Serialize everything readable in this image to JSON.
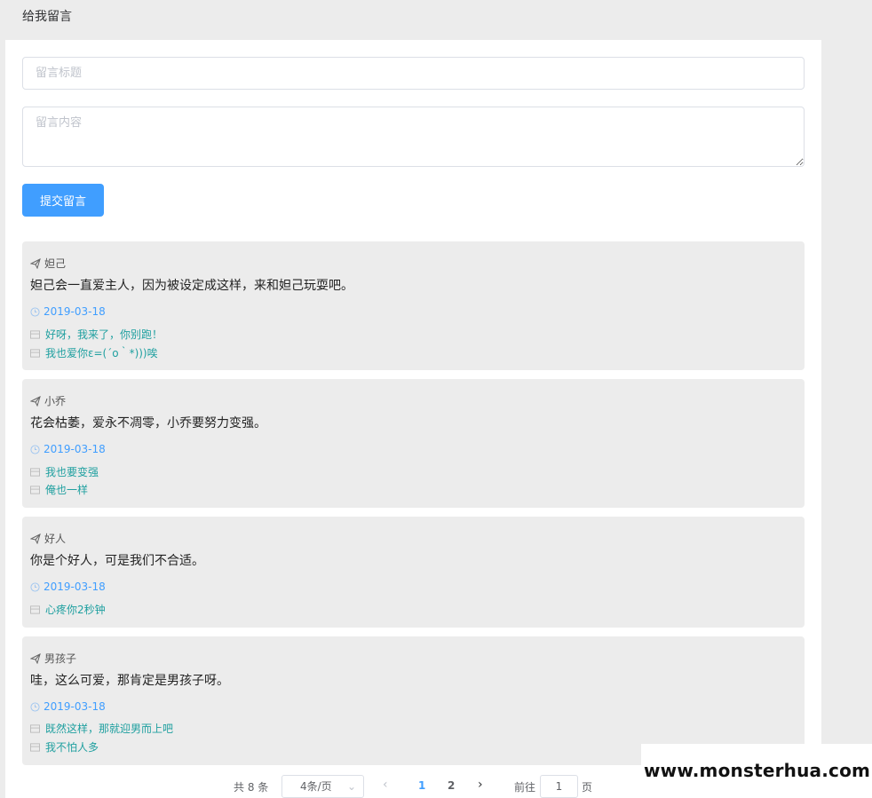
{
  "page": {
    "title": "给我留言"
  },
  "form": {
    "title_placeholder": "留言标题",
    "content_placeholder": "留言内容",
    "submit_label": "提交留言"
  },
  "messages": [
    {
      "author": "妲己",
      "content": "妲己会一直爱主人，因为被设定成这样，来和妲己玩耍吧。",
      "date": "2019-03-18",
      "replies": [
        "好呀，我来了，你别跑！",
        "我也爱你ε=(´ο｀*)))唉"
      ]
    },
    {
      "author": "小乔",
      "content": "花会枯萎，爱永不凋零，小乔要努力变强。",
      "date": "2019-03-18",
      "replies": [
        "我也要变强",
        "俺也一样"
      ]
    },
    {
      "author": "好人",
      "content": "你是个好人，可是我们不合适。",
      "date": "2019-03-18",
      "replies": [
        "心疼你2秒钟"
      ]
    },
    {
      "author": "男孩子",
      "content": "哇，这么可爱，那肯定是男孩子呀。",
      "date": "2019-03-18",
      "replies": [
        "既然这样，那就迎男而上吧",
        "我不怕人多"
      ]
    }
  ],
  "pagination": {
    "total": "共 8 条",
    "page_size": "4条/页",
    "pages": [
      "1",
      "2"
    ],
    "current_page": "1",
    "goto_label": "前往",
    "goto_value": "1",
    "goto_unit": "页"
  },
  "watermark": "www.monsterhua.com",
  "icons": {
    "author": "paper-plane-icon",
    "date": "clock-icon",
    "reply": "message-icon",
    "prev": "chevron-left-icon",
    "next": "chevron-right-icon",
    "dropdown": "chevron-down-icon"
  },
  "colors": {
    "primary": "#409eff",
    "reply_text": "#20a0a0",
    "card_bg": "#ececec"
  }
}
